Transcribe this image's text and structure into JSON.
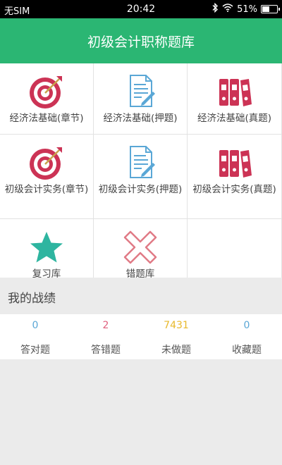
{
  "status_bar": {
    "carrier": "无SIM",
    "time": "20:42",
    "battery": "51%",
    "battery_level": 0.51
  },
  "header": {
    "title": "初级会计职称题库"
  },
  "grid": [
    {
      "label": "经济法基础(章节)",
      "icon": "target-icon"
    },
    {
      "label": "经济法基础(押题)",
      "icon": "document-pen-icon"
    },
    {
      "label": "经济法基础(真题)",
      "icon": "binders-icon"
    },
    {
      "label": "初级会计实务(章节)",
      "icon": "target-icon"
    },
    {
      "label": "初级会计实务(押题)",
      "icon": "document-pen-icon"
    },
    {
      "label": "初级会计实务(真题)",
      "icon": "binders-icon"
    },
    {
      "label": "复习库",
      "icon": "star-icon"
    },
    {
      "label": "错题库",
      "icon": "cross-icon"
    }
  ],
  "record": {
    "title": "我的战绩",
    "stats": [
      {
        "value": "0",
        "label": "答对题",
        "color": "#5aa7d6"
      },
      {
        "value": "2",
        "label": "答错题",
        "color": "#e0607e"
      },
      {
        "value": "7431",
        "label": "未做题",
        "color": "#e8b92c"
      },
      {
        "value": "0",
        "label": "收藏题",
        "color": "#5aa7d6"
      }
    ]
  },
  "colors": {
    "brand": "#2bb673",
    "icon_red": "#cc3355",
    "icon_blue": "#5aa7d6",
    "icon_teal": "#2eb5a0",
    "icon_pink": "#e07a86"
  }
}
